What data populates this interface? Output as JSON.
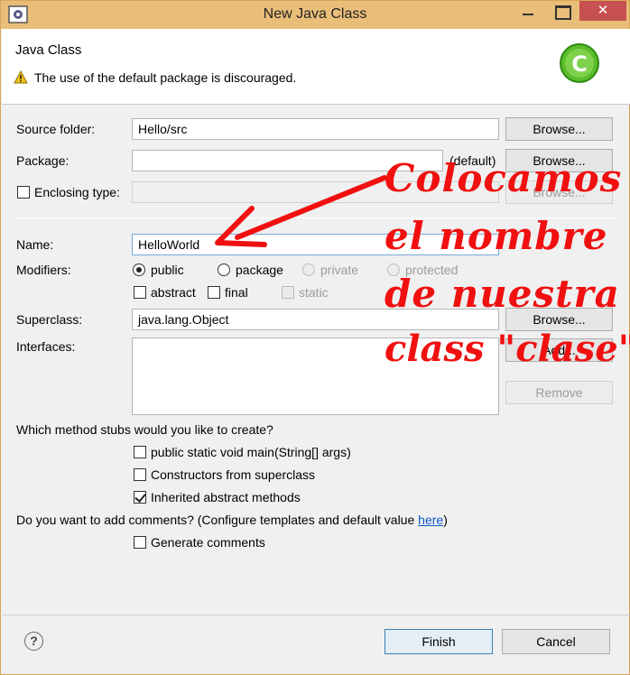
{
  "window": {
    "title": "New Java Class",
    "close_glyph": "✕"
  },
  "header": {
    "title": "Java Class",
    "message": "The use of the default package is discouraged.",
    "warning_icon": "warning-triangle-icon",
    "logo_icon": "new-class-logo-icon",
    "logo_letter": "C"
  },
  "form": {
    "source_folder_label": "Source folder:",
    "source_folder_value": "Hello/src",
    "package_label": "Package:",
    "package_value": "",
    "package_suffix": "(default)",
    "enclosing_type_label": "Enclosing type:",
    "enclosing_type_value": "",
    "browse_label": "Browse...",
    "name_label": "Name:",
    "name_value": "HelloWorld",
    "modifiers_label": "Modifiers:",
    "modifiers": {
      "public": "public",
      "package": "package",
      "private": "private",
      "protected": "protected",
      "abstract": "abstract",
      "final": "final",
      "static": "static"
    },
    "superclass_label": "Superclass:",
    "superclass_value": "java.lang.Object",
    "interfaces_label": "Interfaces:",
    "add_label": "Add...",
    "remove_label": "Remove"
  },
  "stubs": {
    "question": "Which method stubs would you like to create?",
    "main": "public static void main(String[] args)",
    "constructors": "Constructors from superclass",
    "inherited": "Inherited abstract methods"
  },
  "comments": {
    "question_prefix": "Do you want to add comments? (Configure templates and default value ",
    "link": "here",
    "question_suffix": ")",
    "generate": "Generate comments"
  },
  "footer": {
    "help_glyph": "?",
    "finish_label": "Finish",
    "cancel_label": "Cancel"
  },
  "annotation": {
    "line1": "Colocamos",
    "line2": "el nombre",
    "line3": "de nuestra",
    "line4": "class \"clase\"",
    "color": "#f01010"
  }
}
